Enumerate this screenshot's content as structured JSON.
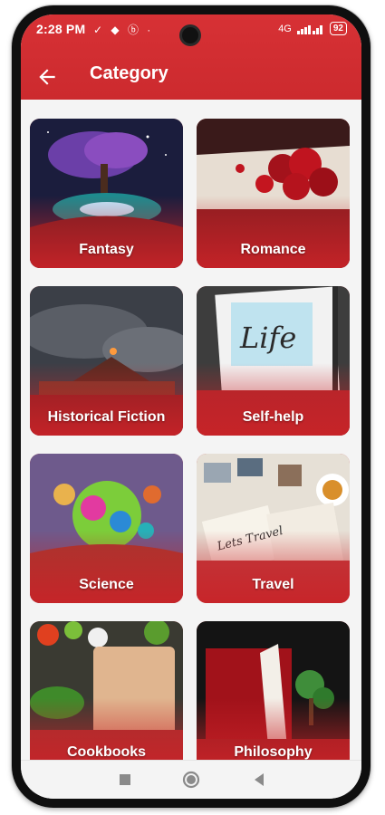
{
  "status_bar": {
    "time": "2:28 PM",
    "network": "4G",
    "battery": "92"
  },
  "header": {
    "title": "Category",
    "back_icon": "arrow-left-icon",
    "background": "#d32f33"
  },
  "categories": [
    {
      "label": "Fantasy"
    },
    {
      "label": "Romance"
    },
    {
      "label": "Historical Fiction"
    },
    {
      "label": "Self-help"
    },
    {
      "label": "Science"
    },
    {
      "label": "Travel"
    },
    {
      "label": "Cookbooks"
    },
    {
      "label": "Philosophy"
    }
  ],
  "nav_bar": {
    "recents_icon": "square-icon",
    "home_icon": "circle-icon",
    "back_icon": "triangle-back-icon"
  }
}
